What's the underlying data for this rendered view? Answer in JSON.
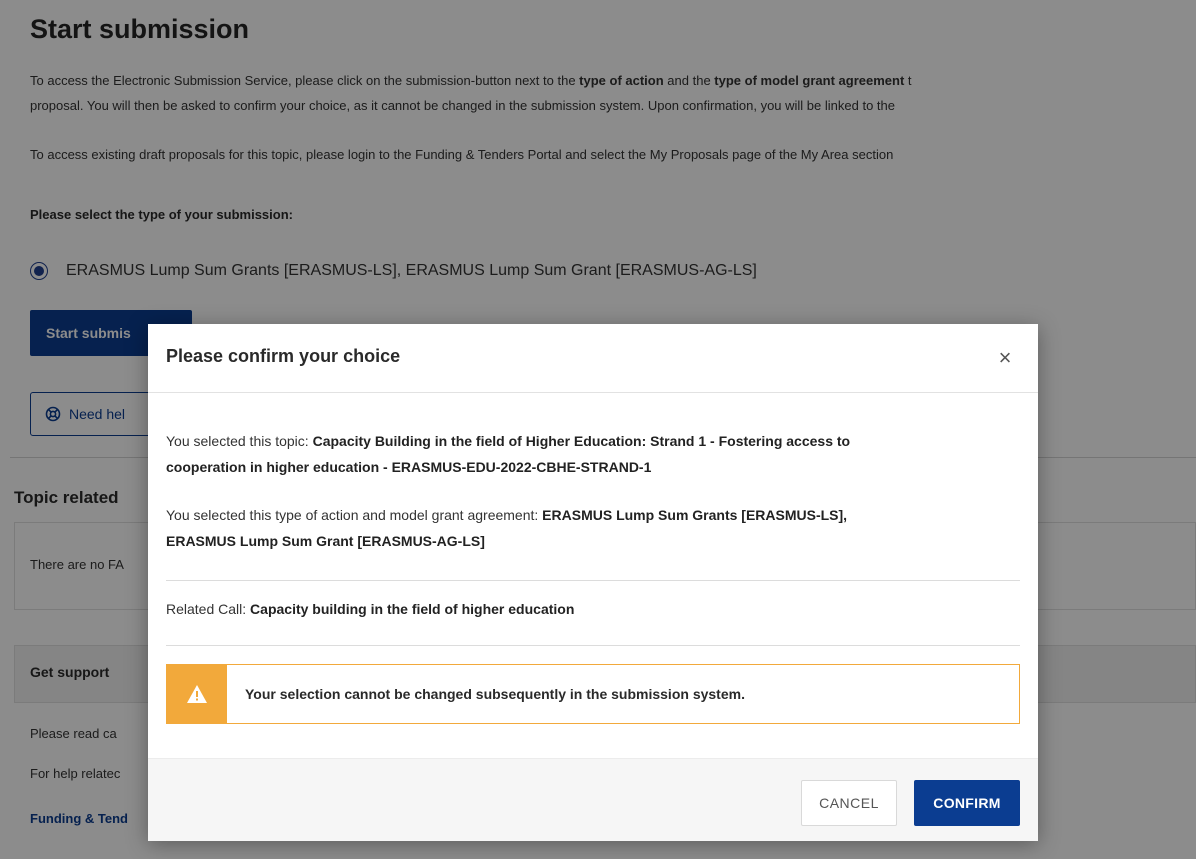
{
  "page": {
    "title": "Start submission",
    "intro_line1_a": "To access the Electronic Submission Service, please click on the submission-button next to the ",
    "intro_line1_b": "type of action",
    "intro_line1_c": " and the ",
    "intro_line1_d": "type of model grant agreement",
    "intro_line1_e": " t",
    "intro_line2": "proposal. You will then be asked to confirm your choice, as it cannot be changed in the submission system. Upon confirmation, you will be linked to the",
    "intro_p2": "To access existing draft proposals for this topic, please login to the Funding & Tenders Portal and select the My Proposals page of the My Area section",
    "select_prompt": "Please select the type of your submission:",
    "radio_label": "ERASMUS Lump Sum Grants [ERASMUS-LS], ERASMUS Lump Sum Grant [ERASMUS-AG-LS]",
    "start_button": "Start submis",
    "help_button": "Need hel",
    "topic_related_heading": "Topic related",
    "no_faq_text": "There are no FA",
    "support_title": "Get support",
    "support_line1": "Please read ca",
    "support_line2": "For help relatec",
    "support_link": "Funding & Tend"
  },
  "modal": {
    "title": "Please confirm your choice",
    "close_label": "×",
    "topic_prefix": "You selected this topic: ",
    "topic_line1": "Capacity Building in the field of Higher Education: Strand 1 - Fostering access to",
    "topic_line2": "cooperation in higher education - ERASMUS-EDU-2022-CBHE-STRAND-1",
    "action_prefix": "You selected this type of action and model grant agreement: ",
    "action_line1": "ERASMUS Lump Sum Grants [ERASMUS-LS],",
    "action_line2": "ERASMUS Lump Sum Grant [ERASMUS-AG-LS]",
    "call_prefix": "Related Call: ",
    "call_value": "Capacity building in the field of higher education",
    "warning": "Your selection cannot be changed subsequently in the submission system.",
    "cancel_label": "CANCEL",
    "confirm_label": "CONFIRM"
  },
  "colors": {
    "primary": "#0b3d91",
    "warning": "#f2a93b"
  }
}
